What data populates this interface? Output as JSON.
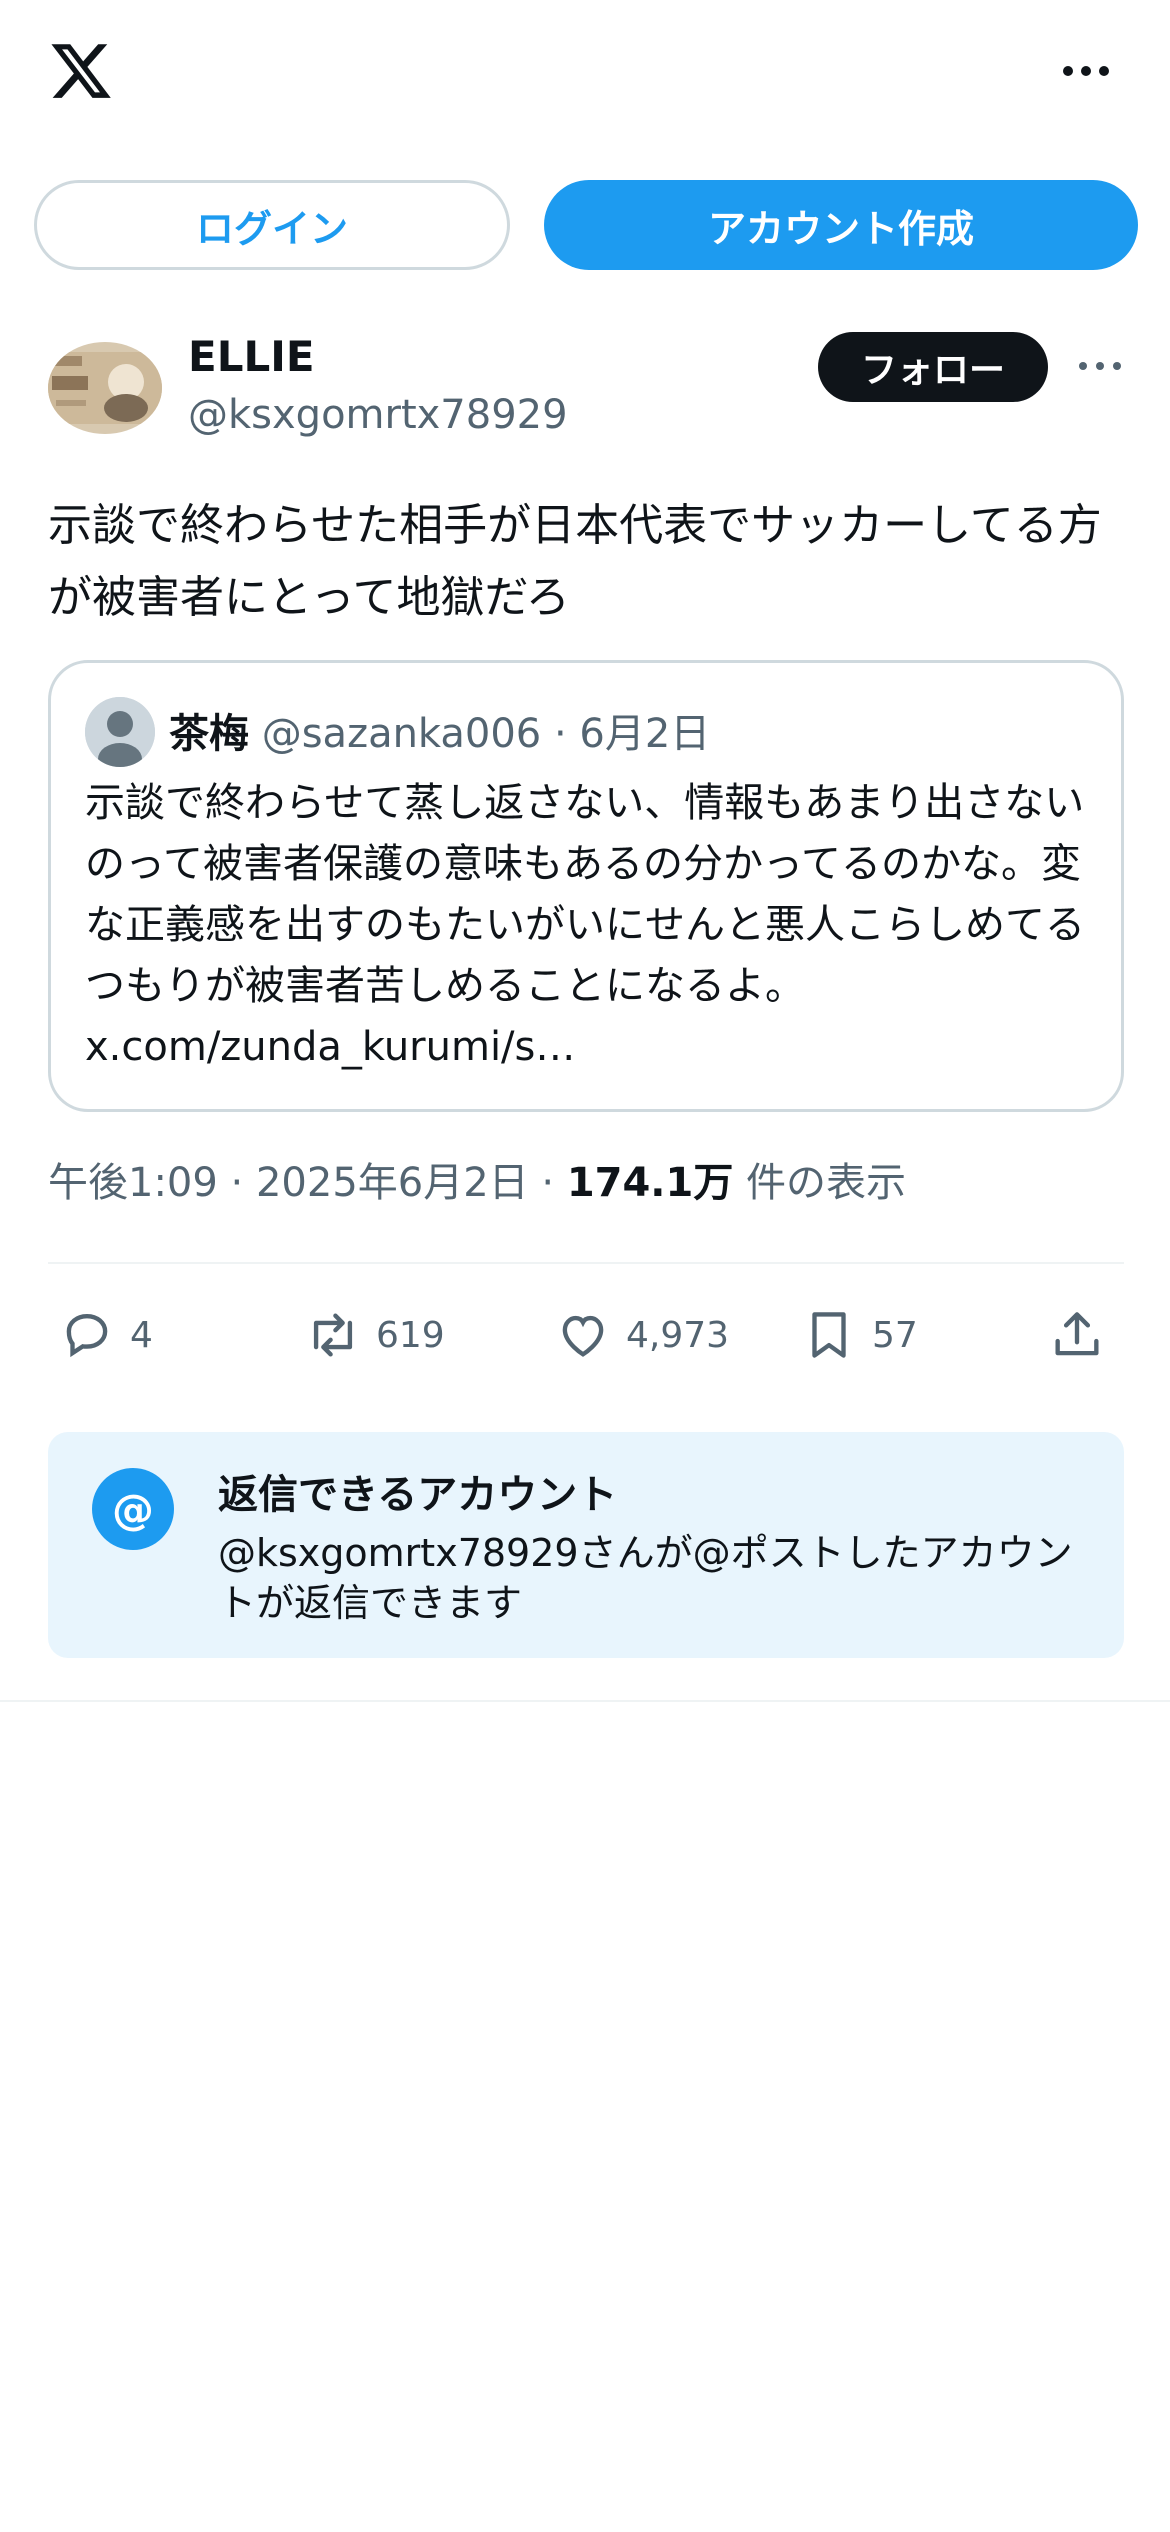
{
  "header": {
    "logo_icon": "x-logo-icon",
    "more_icon": "more-horizontal-icon"
  },
  "auth": {
    "login_label": "ログイン",
    "signup_label": "アカウント作成"
  },
  "post": {
    "author_name": "ELLIE",
    "author_handle": "@ksxgomrtx78929",
    "follow_label": "フォロー",
    "text": "示談で終わらせた相手が日本代表でサッカーしてる方が被害者にとって地獄だろ",
    "quote": {
      "name": "茶梅",
      "handle": "@sazanka006",
      "date": "· 6月2日",
      "text": "示談で終わらせて蒸し返さない、情報もあまり出さないのって被害者保護の意味もあるの分かってるのかな。変な正義感を出すのもたいがいにせんと悪人こらしめてるつもりが被害者苦しめることになるよ。 x.com/zunda_kurumi/s…"
    },
    "time": "午後1:09 · 2025年6月2日 · ",
    "views_count": "174.1万",
    "views_label": " 件の表示",
    "actions": {
      "replies": "4",
      "reposts": "619",
      "likes": "4,973",
      "bookmarks": "57"
    }
  },
  "reply_info": {
    "title": "返信できるアカウント",
    "description": "@ksxgomrtx78929さんが@ポストしたアカウントが返信できます",
    "icon_text": "@"
  },
  "colors": {
    "accent": "#1d9bf0",
    "text": "#0f1419",
    "muted": "#536471",
    "reply_bg": "#e8f5fd"
  }
}
